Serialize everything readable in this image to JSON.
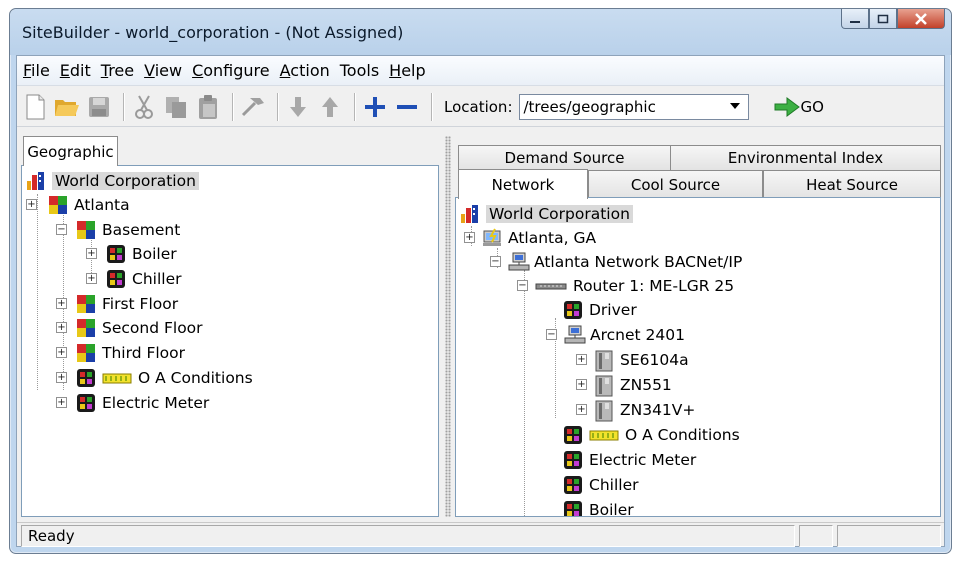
{
  "window": {
    "title": "SiteBuilder - world_corporation - (Not Assigned)",
    "controls": [
      "minimize",
      "maximize",
      "close"
    ]
  },
  "menu": [
    {
      "label": "File",
      "accel": "F",
      "rest": "ile"
    },
    {
      "label": "Edit",
      "accel": "E",
      "rest": "dit"
    },
    {
      "label": "Tree",
      "accel": "T",
      "rest": "ree"
    },
    {
      "label": "View",
      "accel": "V",
      "rest": "iew"
    },
    {
      "label": "Configure",
      "accel": "C",
      "rest": "onfigure"
    },
    {
      "label": "Action",
      "accel": "A",
      "rest": "ction"
    },
    {
      "label": "Tools",
      "accel": "",
      "rest": "Tools"
    },
    {
      "label": "Help",
      "accel": "H",
      "rest": "elp"
    }
  ],
  "toolbar": {
    "location_label": "Location:",
    "location_value": "/trees/geographic",
    "go_label": "GO"
  },
  "left_tabs": [
    "Geographic"
  ],
  "left_tree": [
    {
      "label": "World Corporation",
      "icon": "building-icon",
      "selected": true
    },
    {
      "label": "Atlanta",
      "icon": "floorplan-icon"
    },
    {
      "label": "Basement",
      "icon": "floorplan-icon"
    },
    {
      "label": "Boiler",
      "icon": "equipment-icon"
    },
    {
      "label": "Chiller",
      "icon": "equipment-icon"
    },
    {
      "label": "First Floor",
      "icon": "floorplan-icon"
    },
    {
      "label": "Second Floor",
      "icon": "floorplan-icon"
    },
    {
      "label": "Third Floor",
      "icon": "floorplan-icon"
    },
    {
      "label": "O A Conditions",
      "icon": "equipment-icon"
    },
    {
      "label": "Electric Meter",
      "icon": "equipment-icon"
    }
  ],
  "right_tabs": {
    "top_row": [
      "Demand Source",
      "Environmental Index"
    ],
    "bottom_row": [
      "Network",
      "Cool Source",
      "Heat Source"
    ]
  },
  "right_tree": [
    {
      "label": "World Corporation",
      "icon": "building-icon",
      "selected": true
    },
    {
      "label": "Atlanta, GA",
      "icon": "site-icon"
    },
    {
      "label": "Atlanta Network BACNet/IP",
      "icon": "network-icon"
    },
    {
      "label": "Router 1: ME-LGR 25",
      "icon": "router-icon"
    },
    {
      "label": "Driver",
      "icon": "equipment-icon"
    },
    {
      "label": "Arcnet 2401",
      "icon": "network-icon"
    },
    {
      "label": "SE6104a",
      "icon": "controller-icon"
    },
    {
      "label": "ZN551",
      "icon": "controller-icon"
    },
    {
      "label": "ZN341V+",
      "icon": "controller-icon"
    },
    {
      "label": "O A Conditions",
      "icon": "equipment-icon"
    },
    {
      "label": "Electric Meter",
      "icon": "equipment-icon"
    },
    {
      "label": "Chiller",
      "icon": "equipment-icon"
    },
    {
      "label": "Boiler",
      "icon": "equipment-icon"
    }
  ],
  "status": {
    "text": "Ready"
  }
}
